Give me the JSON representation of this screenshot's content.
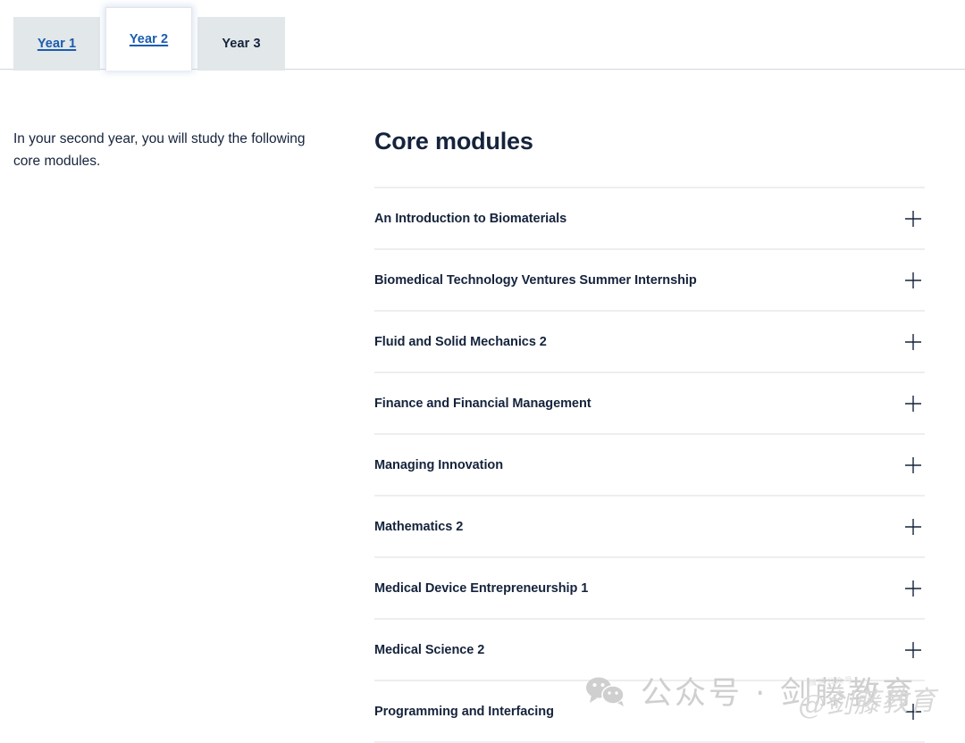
{
  "tabs": [
    {
      "label": "Year 1",
      "state": "link"
    },
    {
      "label": "Year 2",
      "state": "active"
    },
    {
      "label": "Year 3",
      "state": "plain"
    }
  ],
  "intro": {
    "text": "In your second year, you will study the following core modules."
  },
  "modules_section": {
    "title": "Core modules",
    "expand_icon": "plus-icon",
    "items": [
      {
        "title": "An Introduction to Biomaterials"
      },
      {
        "title": "Biomedical Technology Ventures Summer Internship"
      },
      {
        "title": "Fluid and Solid Mechanics 2"
      },
      {
        "title": "Finance and Financial Management"
      },
      {
        "title": "Managing Innovation"
      },
      {
        "title": "Mathematics 2"
      },
      {
        "title": "Medical Device Entrepreneurship 1"
      },
      {
        "title": "Medical Science 2"
      },
      {
        "title": "Programming and Interfacing"
      }
    ]
  },
  "watermark": {
    "icon": "wechat-icon",
    "text": "公众号 · 剑藤教育",
    "overlay_text": "@剑藤教育",
    "overlay_small": "微信公众号",
    "color": "#cfcfcf"
  },
  "colors": {
    "navy": "#15233c",
    "link_blue": "#1a5cb0",
    "tab_gray": "#e2e7e9",
    "divider": "#eceef0",
    "rule": "#cfd6dd"
  }
}
